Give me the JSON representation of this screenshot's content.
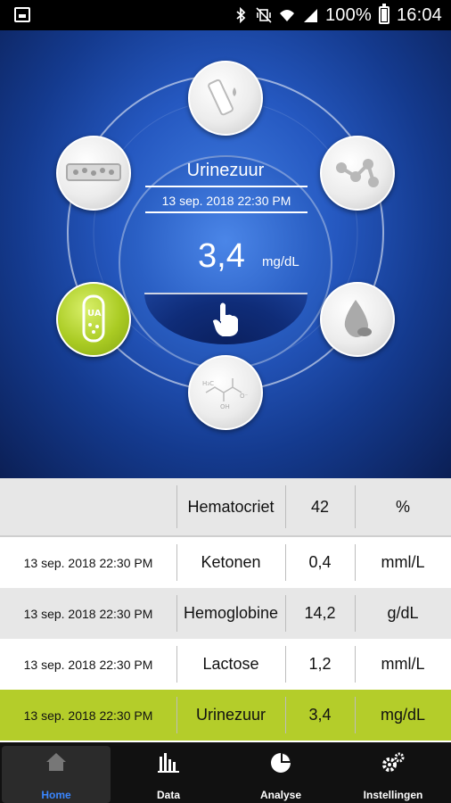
{
  "status_bar": {
    "battery_percent": "100%",
    "time": "16:04",
    "icons": [
      "screenshot-icon",
      "bluetooth-icon",
      "mute-vibrate-icon",
      "wifi-icon",
      "signal-icon",
      "battery-icon"
    ]
  },
  "hero": {
    "selected_test": "Urinezuur",
    "datetime": "13 sep. 2018 22:30 PM",
    "value": "3,4",
    "unit": "mg/dL",
    "nodes": [
      {
        "name": "test-strip-icon",
        "active": false
      },
      {
        "name": "molecule-icon",
        "active": false
      },
      {
        "name": "blood-drop-icon",
        "active": false
      },
      {
        "name": "lactate-formula-icon",
        "active": false
      },
      {
        "name": "uric-acid-tube-icon",
        "active": true
      },
      {
        "name": "blood-cells-icon",
        "active": false
      }
    ],
    "accent_color": "#aacb23"
  },
  "table": {
    "rows": [
      {
        "date": "",
        "test": "Hematocriet",
        "value": "42",
        "unit": "%"
      },
      {
        "date": "13 sep. 2018 22:30 PM",
        "test": "Ketonen",
        "value": "0,4",
        "unit": "mml/L"
      },
      {
        "date": "13 sep. 2018 22:30 PM",
        "test": "Hemoglobine",
        "value": "14,2",
        "unit": "g/dL"
      },
      {
        "date": "13 sep. 2018 22:30 PM",
        "test": "Lactose",
        "value": "1,2",
        "unit": "mml/L"
      },
      {
        "date": "13 sep. 2018 22:30 PM",
        "test": "Urinezuur",
        "value": "3,4",
        "unit": "mg/dL"
      }
    ],
    "highlight_color": "#b4cd2a"
  },
  "nav": {
    "items": [
      {
        "label": "Home",
        "icon": "home-icon",
        "active": true
      },
      {
        "label": "Data",
        "icon": "bar-chart-icon",
        "active": false
      },
      {
        "label": "Analyse",
        "icon": "pie-chart-icon",
        "active": false
      },
      {
        "label": "Instellingen",
        "icon": "gears-icon",
        "active": false
      }
    ],
    "active_color": "#3a86ff"
  }
}
